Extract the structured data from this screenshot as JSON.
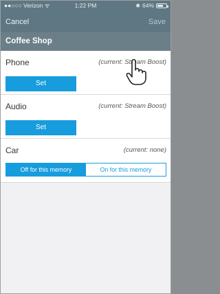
{
  "status": {
    "carrier": "●●○○○ Verizon",
    "wifi_icon": "wifi-icon",
    "time": "1:22 PM",
    "bluetooth": "✱",
    "battery_text": "64%",
    "battery_level_percent": 64
  },
  "nav": {
    "cancel_label": "Cancel",
    "save_label": "Save"
  },
  "section_title": "Coffee Shop",
  "rows": [
    {
      "label": "Phone",
      "current": "(current: Stream Boost)",
      "action": "Set"
    },
    {
      "label": "Audio",
      "current": "(current: Stream Boost)",
      "action": "Set"
    },
    {
      "label": "Car",
      "current": "(current: none)"
    }
  ],
  "car_toggle": {
    "off_label": "Off for this memory",
    "on_label": "On for this memory",
    "selected": "off"
  },
  "colors": {
    "header_bg": "#5f7782",
    "section_bg": "#6b7f88",
    "accent": "#179cdd",
    "content_bg": "#f1f1f3"
  },
  "cursor_icon": "hand-pointer-icon"
}
